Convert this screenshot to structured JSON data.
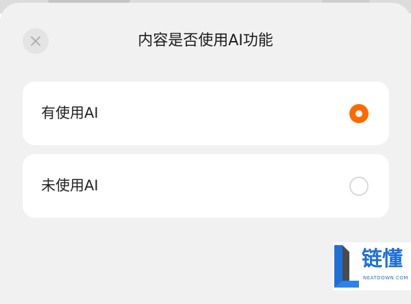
{
  "dialog": {
    "title": "内容是否使用AI功能",
    "close_icon": "close-icon",
    "options": [
      {
        "label": "有使用AI",
        "selected": true
      },
      {
        "label": "未使用AI",
        "selected": false
      }
    ],
    "accent_color": "#ff6a00"
  },
  "watermark": {
    "name": "链懂",
    "site": "NEATDOWN.COM",
    "logo_icon": "neatdown-logo-icon"
  }
}
